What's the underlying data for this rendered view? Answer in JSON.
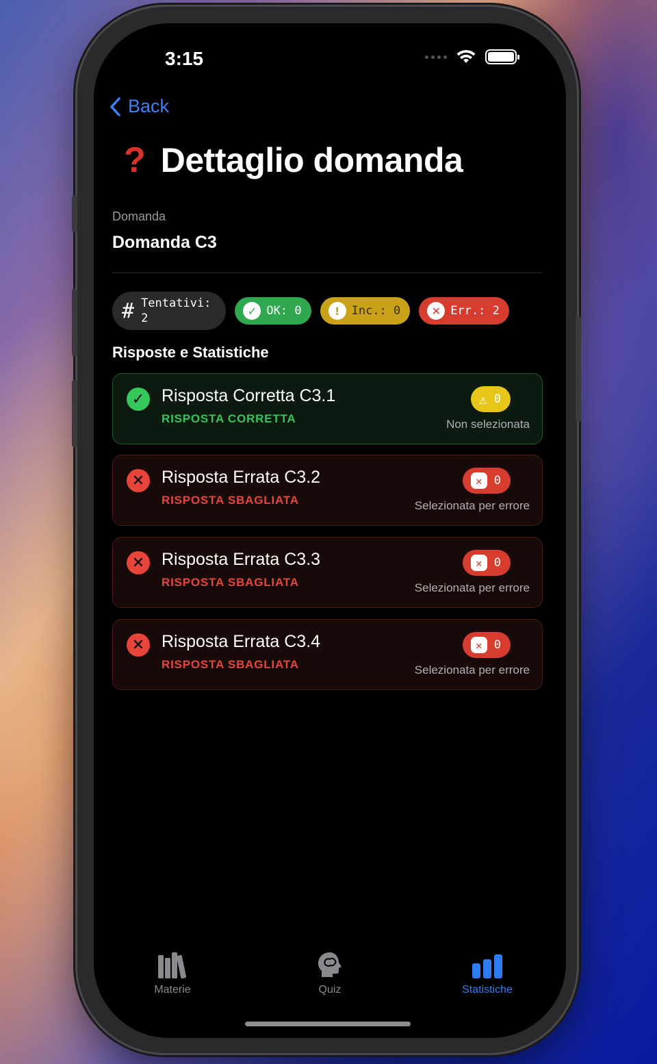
{
  "status_bar": {
    "time": "3:15"
  },
  "nav": {
    "back_label": "Back"
  },
  "header": {
    "icon": "❓",
    "title": "Dettaglio domanda"
  },
  "question": {
    "label": "Domanda",
    "value": "Domanda C3"
  },
  "chips": {
    "attempts": "Tentativi:\n2",
    "ok": "OK: 0",
    "incomplete": "Inc.: 0",
    "errors": "Err.: 2"
  },
  "section_title": "Risposte e Statistiche",
  "answers": [
    {
      "text": "Risposta Corretta C3.1",
      "kind": "RISPOSTA CORRETTA",
      "count": "0",
      "status": "Non selezionata"
    },
    {
      "text": "Risposta Errata C3.2",
      "kind": "RISPOSTA SBAGLIATA",
      "count": "0",
      "status": "Selezionata per errore"
    },
    {
      "text": "Risposta Errata C3.3",
      "kind": "RISPOSTA SBAGLIATA",
      "count": "0",
      "status": "Selezionata per errore"
    },
    {
      "text": "Risposta Errata C3.4",
      "kind": "RISPOSTA SBAGLIATA",
      "count": "0",
      "status": "Selezionata per errore"
    }
  ],
  "tabbar": {
    "items": [
      {
        "label": "Materie",
        "icon": "books-icon"
      },
      {
        "label": "Quiz",
        "icon": "brain-head-icon"
      },
      {
        "label": "Statistiche",
        "icon": "bar-chart-icon",
        "active": true
      }
    ]
  },
  "colors": {
    "accent": "#2f7cf6",
    "ok": "#34c759",
    "warn": "#e6c619",
    "error": "#e8453a"
  }
}
